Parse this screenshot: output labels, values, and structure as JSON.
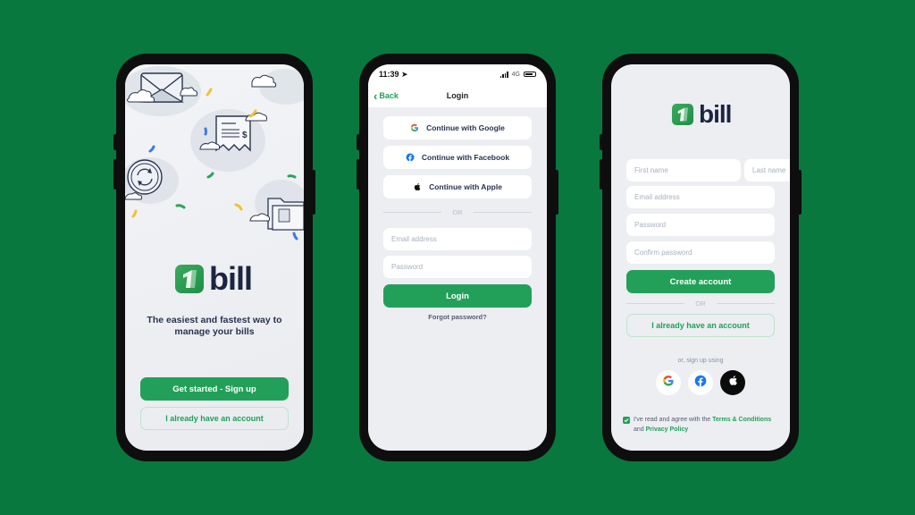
{
  "colors": {
    "background": "#08783f",
    "accent": "#22a05a",
    "text_dark": "#1c2540",
    "screen": "#eceef2"
  },
  "brand": {
    "name": "bill",
    "mark_icon": "one-bill-logo-icon"
  },
  "welcome_screen": {
    "illustration_icons": [
      "envelope-icon",
      "receipt-icon",
      "sync-coin-icon",
      "folder-icon",
      "cloud-icon"
    ],
    "tagline_line1": "The easiest and fastest way to",
    "tagline_line2": "manage your bills",
    "primary_button": "Get started - Sign up",
    "secondary_button": "I already have an account"
  },
  "login_screen": {
    "status_time": "11:39",
    "status_network": "4G",
    "back_label": "Back",
    "title": "Login",
    "social": [
      {
        "label": "Continue with Google",
        "icon": "google-icon"
      },
      {
        "label": "Continue with Facebook",
        "icon": "facebook-icon"
      },
      {
        "label": "Continue with Apple",
        "icon": "apple-icon"
      }
    ],
    "or_label": "OR",
    "email_placeholder": "Email address",
    "password_placeholder": "Password",
    "login_button": "Login",
    "forgot_password": "Forgot password?"
  },
  "signup_screen": {
    "first_name_placeholder": "First name",
    "last_name_placeholder": "Last name",
    "email_placeholder": "Email address",
    "password_placeholder": "Password",
    "confirm_password_placeholder": "Confirm password",
    "create_button": "Create account",
    "or_label": "OR",
    "have_account_button": "I already have an account",
    "social_label": "or, sign up using",
    "social_icons": [
      "google-icon",
      "facebook-icon",
      "apple-icon"
    ],
    "terms_checked": true,
    "terms_prefix": "I've read and agree with the ",
    "terms_link": "Terms & Conditions",
    "terms_and": "and ",
    "privacy_link": "Privacy Policy"
  }
}
